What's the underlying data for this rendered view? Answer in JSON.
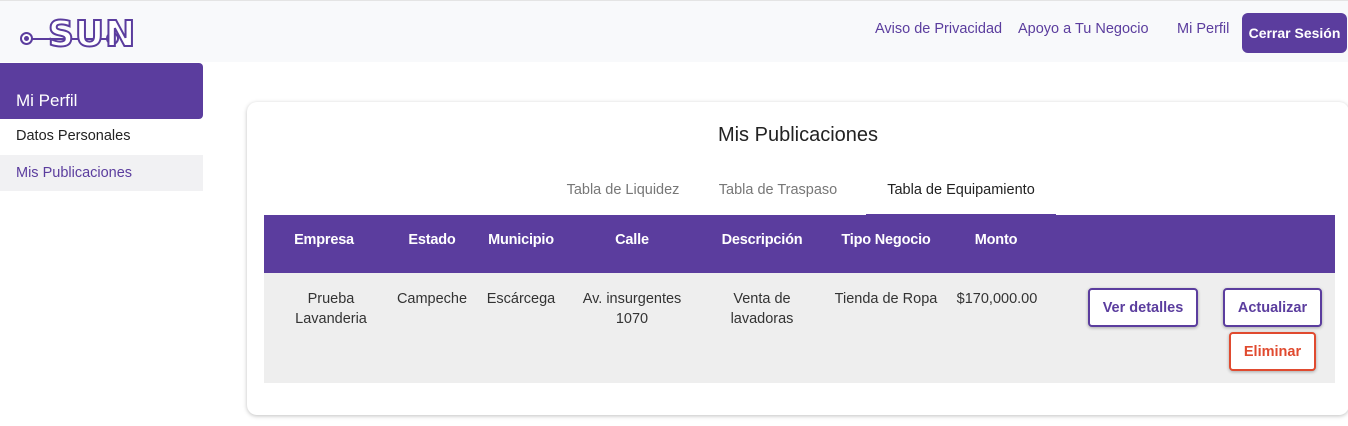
{
  "header": {
    "logo_text": "SUN",
    "links": {
      "privacy": "Aviso de Privacidad",
      "support": "Apoyo a Tu Negocio",
      "profile": "Mi Perfil"
    },
    "logout_label": "Cerrar Sesión"
  },
  "sidebar": {
    "title": "Mi Perfil",
    "items": [
      {
        "label": "Datos Personales"
      },
      {
        "label": "Mis Publicaciones"
      }
    ]
  },
  "main": {
    "title": "Mis Publicaciones",
    "tabs": [
      {
        "label": "Tabla de Liquidez"
      },
      {
        "label": "Tabla de Traspaso"
      },
      {
        "label": "Tabla de Equipamiento"
      }
    ],
    "active_tab": "Tabla de Equipamiento",
    "table": {
      "columns": [
        "Empresa",
        "Estado",
        "Municipio",
        "Calle",
        "Descripción",
        "Tipo Negocio",
        "Monto"
      ],
      "rows": [
        {
          "empresa": [
            "Prueba",
            "Lavanderia"
          ],
          "estado": "Campeche",
          "municipio": "Escárcega",
          "calle": [
            "Av. insurgentes",
            "1070"
          ],
          "descripcion": [
            "Venta de",
            "lavadoras"
          ],
          "tipo_negocio": "Tienda de Ropa",
          "monto": "$170,000.00",
          "actions": {
            "details": "Ver detalles",
            "update": "Actualizar",
            "delete": "Eliminar"
          }
        }
      ]
    }
  },
  "colors": {
    "primary": "#5b3d9e",
    "danger": "#e04a2f",
    "row_bg": "#eeeeee",
    "header_bg": "#f8f9fb"
  }
}
